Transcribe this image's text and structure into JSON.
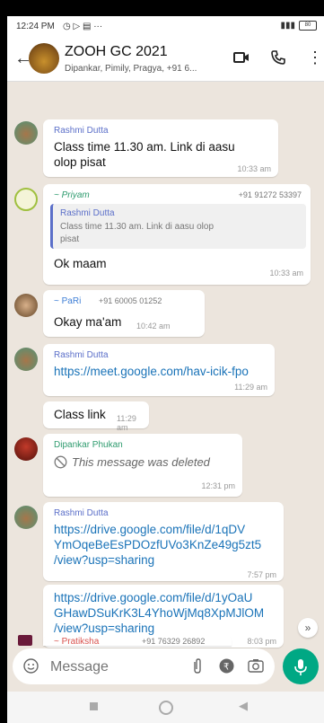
{
  "status_bar": {
    "time": "12:24 PM",
    "left_icons": "◷ ▷ ▤ ···",
    "battery": "80"
  },
  "header": {
    "title": "ZOOH GC 2021",
    "subtitle": "Dipankar, Pimily, Pragya, +91 6..."
  },
  "messages": [
    {
      "sender": "Rashmi Dutta",
      "text_l1": "Class time 11.30 am. Link di aasu",
      "text_l2": "olop pisat",
      "time": "10:33 am"
    },
    {
      "sender": "~ Priyam",
      "phone": "+91 91272 53397",
      "quote_sender": "Rashmi Dutta",
      "quote_l1": "Class time 11.30 am. Link di aasu olop",
      "quote_l2": "pisat",
      "text": "Ok maam",
      "time": "10:33 am"
    },
    {
      "sender": "~ PaRi",
      "phone": "+91 60005 01252",
      "text": "Okay ma'am",
      "time": "10:42 am"
    },
    {
      "sender": "Rashmi Dutta",
      "text": "https://meet.google.com/hav-icik-fpo",
      "time": "11:29 am"
    },
    {
      "text": "Class link",
      "time": "11:29 am"
    },
    {
      "sender": "Dipankar Phukan",
      "text": "This message was deleted",
      "time": "12:31 pm"
    },
    {
      "sender": "Rashmi Dutta",
      "text_l1": "https://drive.google.com/file/d/1qDV",
      "text_l2": "YmOqeBeEsPDOzfUVo3KnZe49g5zt5",
      "text_l3": "/view?usp=sharing",
      "time": "7:57 pm"
    },
    {
      "text_l1": "https://drive.google.com/file/d/1yOaU",
      "text_l2": "GHawDSuKrK3L4YhoWjMq8XpMJlOM",
      "text_l3": "/view?usp=sharing",
      "time": "8:03 pm"
    },
    {
      "sender": "~ Pratiksha",
      "phone": "+91 76329 26892"
    }
  ],
  "composer": {
    "placeholder": "Message"
  },
  "colors": {
    "accent": "#00a884",
    "link": "#1a73b8",
    "rashmi": "#5b6fc9",
    "priyam": "#2e9b6e",
    "pari": "#3f7fd6",
    "dipankar": "#2e9b6e",
    "pratiksha": "#d9534f"
  }
}
